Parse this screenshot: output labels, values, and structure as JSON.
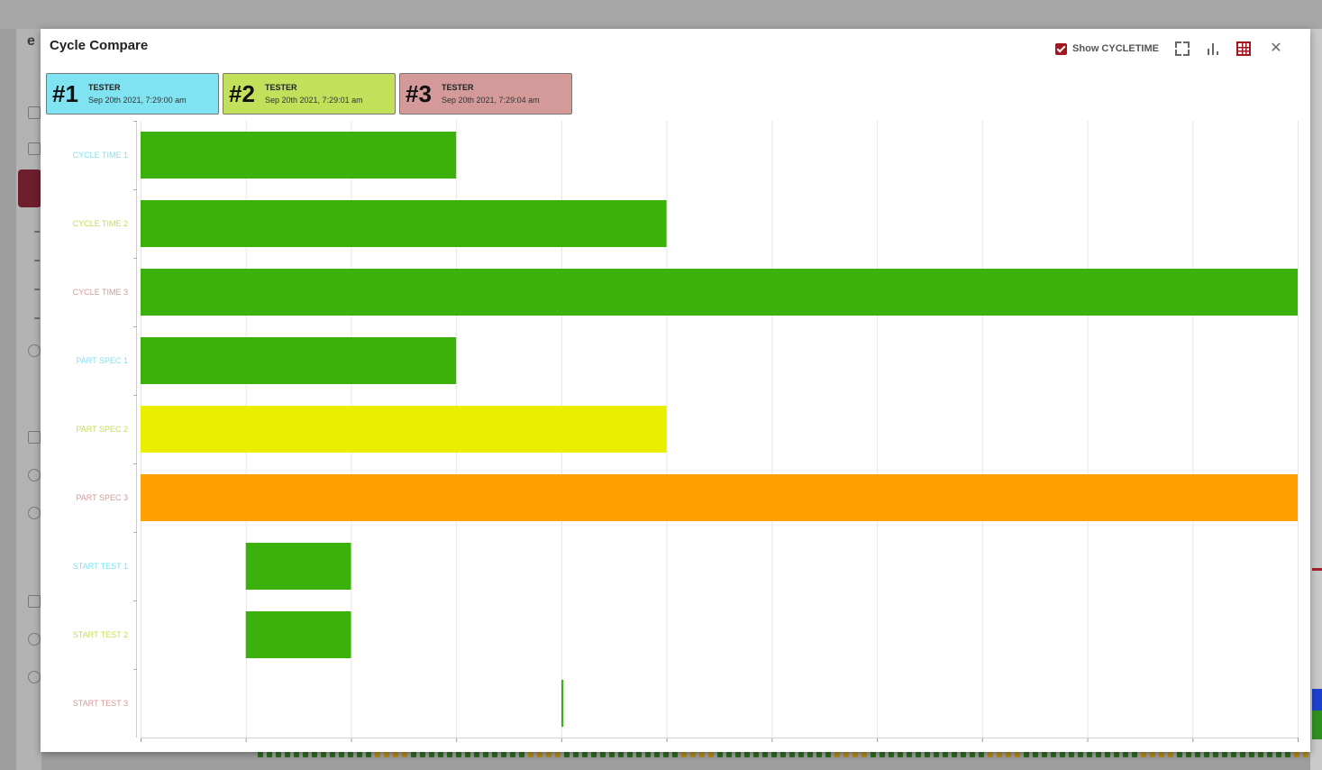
{
  "modal": {
    "title": "Cycle Compare"
  },
  "toolbar": {
    "show_label": "Show CYCLETIME",
    "show_checked": true,
    "icons": [
      "fullscreen-icon",
      "bar-chart-icon",
      "table-icon",
      "close-icon"
    ],
    "close_glyph": "✕"
  },
  "cycles": [
    {
      "num": "#1",
      "name": "TESTER",
      "date": "Sep 20th 2021, 7:29:00 am",
      "color": "#7fe3f2"
    },
    {
      "num": "#2",
      "name": "TESTER",
      "date": "Sep 20th 2021, 7:29:01 am",
      "color": "#c2e05a"
    },
    {
      "num": "#3",
      "name": "TESTER",
      "date": "Sep 20th 2021, 7:29:04 am",
      "color": "#d49a9a"
    }
  ],
  "chart_data": {
    "type": "bar",
    "orientation": "horizontal",
    "x_axis": {
      "min": 0,
      "max": 11,
      "tick_labels": "none",
      "grid": true
    },
    "categories": [
      "CYCLE TIME 1",
      "CYCLE TIME 2",
      "CYCLE TIME 3",
      "PART SPEC 1",
      "PART SPEC 2",
      "PART SPEC 3",
      "START TEST 1",
      "START TEST 2",
      "START TEST 3"
    ],
    "category_colors": [
      "#7fe3f2",
      "#c2e05a",
      "#d49a9a",
      "#7fe3f2",
      "#c2e05a",
      "#d49a9a",
      "#7fe3f2",
      "#c2e05a",
      "#d49a9a"
    ],
    "bars": [
      {
        "start": 0,
        "end": 3,
        "color": "#3cb10b"
      },
      {
        "start": 0,
        "end": 5,
        "color": "#3cb10b"
      },
      {
        "start": 0,
        "end": 11,
        "color": "#3cb10b"
      },
      {
        "start": 0,
        "end": 3,
        "color": "#3cb10b"
      },
      {
        "start": 0,
        "end": 5,
        "color": "#eaee00"
      },
      {
        "start": 0,
        "end": 11,
        "color": "#ffa000"
      },
      {
        "start": 1,
        "end": 2,
        "color": "#3cb10b"
      },
      {
        "start": 1,
        "end": 2,
        "color": "#3cb10b"
      },
      {
        "start": 4,
        "end": 4.02,
        "color": "#3cb10b"
      }
    ]
  }
}
